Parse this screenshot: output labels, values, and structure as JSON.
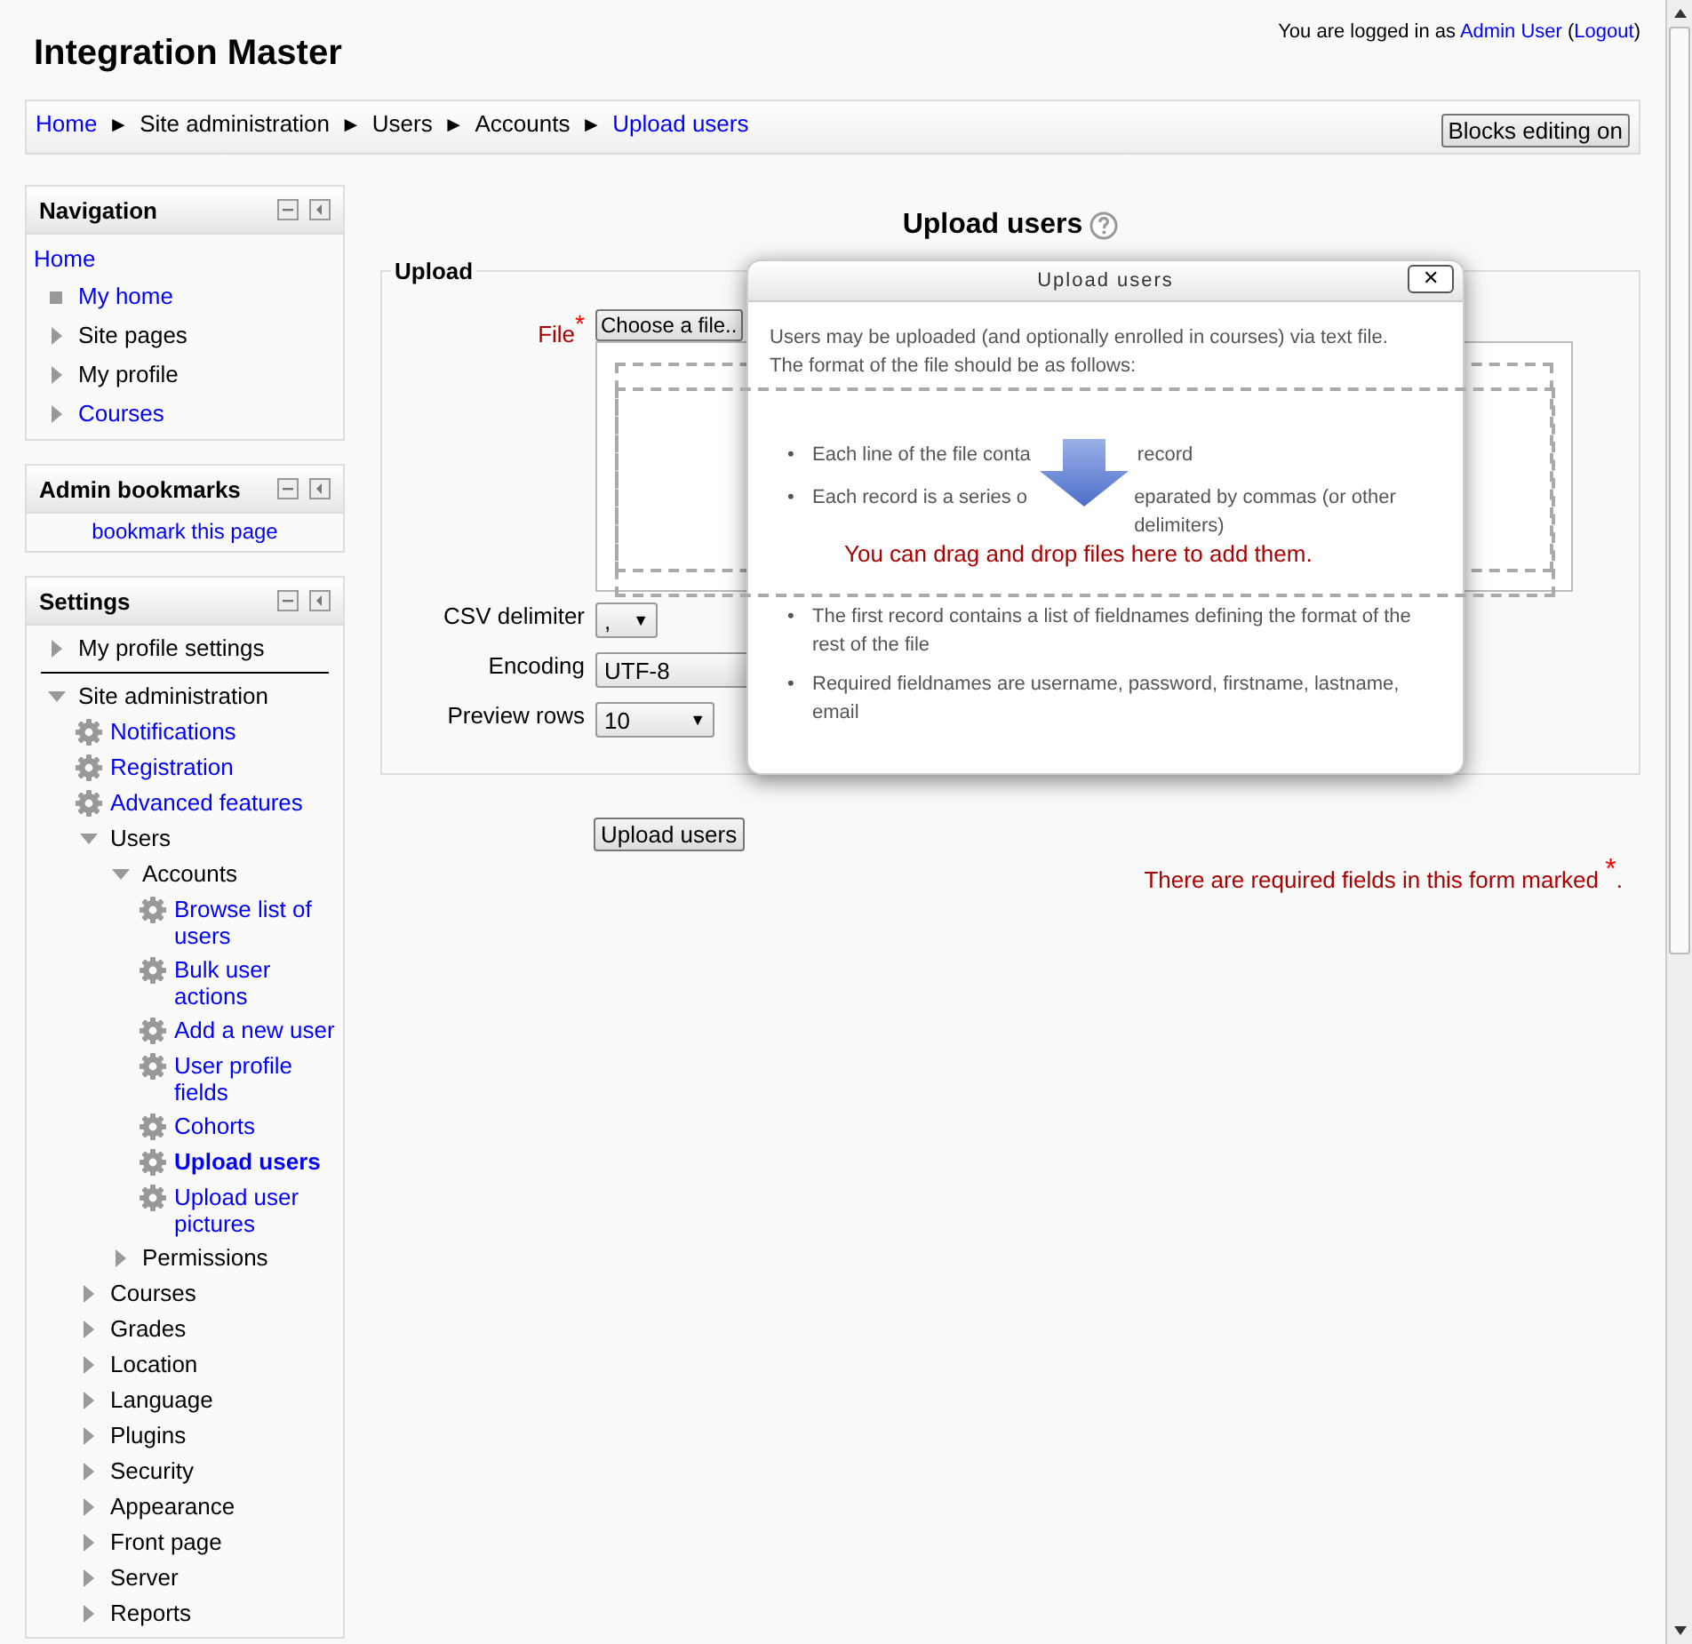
{
  "header": {
    "title": "Integration Master",
    "login": {
      "prefix": "You are logged in as",
      "user": "Admin User",
      "open": "(",
      "logout": "Logout",
      "close": ")"
    }
  },
  "breadcrumb": {
    "items": [
      {
        "label": "Home",
        "link": true
      },
      {
        "label": "Site administration",
        "link": false
      },
      {
        "label": "Users",
        "link": false
      },
      {
        "label": "Accounts",
        "link": false
      },
      {
        "label": "Upload users",
        "link": true
      }
    ],
    "separator": "►",
    "button": "Blocks editing on"
  },
  "navigation": {
    "title": "Navigation",
    "items": [
      {
        "label": "Home",
        "kind": "plain-link"
      },
      {
        "label": "My home",
        "kind": "bullet-link"
      },
      {
        "label": "Site pages",
        "kind": "branch",
        "expanded": false,
        "link": false
      },
      {
        "label": "My profile",
        "kind": "branch",
        "expanded": false,
        "link": false
      },
      {
        "label": "Courses",
        "kind": "branch",
        "expanded": false,
        "link": true
      }
    ]
  },
  "bookmarks": {
    "title": "Admin bookmarks",
    "link": "bookmark this page"
  },
  "settings": {
    "title": "Settings",
    "items": [
      {
        "label": "My profile settings",
        "kind": "branch",
        "expanded": false,
        "link": false
      },
      {
        "label": "Site administration",
        "kind": "branch",
        "expanded": true,
        "link": false,
        "children": [
          {
            "label": "Notifications",
            "kind": "setting",
            "current": false
          },
          {
            "label": "Registration",
            "kind": "setting",
            "current": false
          },
          {
            "label": "Advanced features",
            "kind": "setting",
            "current": false
          },
          {
            "label": "Users",
            "kind": "branch",
            "expanded": true,
            "link": false,
            "children": [
              {
                "label": "Accounts",
                "kind": "branch",
                "expanded": true,
                "link": false,
                "children": [
                  {
                    "label": "Browse list of users",
                    "kind": "setting",
                    "current": false
                  },
                  {
                    "label": "Bulk user actions",
                    "kind": "setting",
                    "current": false
                  },
                  {
                    "label": "Add a new user",
                    "kind": "setting",
                    "current": false
                  },
                  {
                    "label": "User profile fields",
                    "kind": "setting",
                    "current": false
                  },
                  {
                    "label": "Cohorts",
                    "kind": "setting",
                    "current": false
                  },
                  {
                    "label": "Upload users",
                    "kind": "setting",
                    "current": true
                  },
                  {
                    "label": "Upload user pictures",
                    "kind": "setting",
                    "current": false
                  }
                ]
              },
              {
                "label": "Permissions",
                "kind": "branch",
                "expanded": false,
                "link": false
              }
            ]
          },
          {
            "label": "Courses",
            "kind": "branch",
            "expanded": false,
            "link": false
          },
          {
            "label": "Grades",
            "kind": "branch",
            "expanded": false,
            "link": false
          },
          {
            "label": "Location",
            "kind": "branch",
            "expanded": false,
            "link": false
          },
          {
            "label": "Language",
            "kind": "branch",
            "expanded": false,
            "link": false
          },
          {
            "label": "Plugins",
            "kind": "branch",
            "expanded": false,
            "link": false
          },
          {
            "label": "Security",
            "kind": "branch",
            "expanded": false,
            "link": false
          },
          {
            "label": "Appearance",
            "kind": "branch",
            "expanded": false,
            "link": false
          },
          {
            "label": "Front page",
            "kind": "branch",
            "expanded": false,
            "link": false
          },
          {
            "label": "Server",
            "kind": "branch",
            "expanded": false,
            "link": false
          },
          {
            "label": "Reports",
            "kind": "branch",
            "expanded": false,
            "link": false
          }
        ]
      }
    ]
  },
  "main": {
    "heading": "Upload users",
    "fieldset": "Upload",
    "file": {
      "label": "File",
      "required": "*",
      "button": "Choose a file..",
      "drop_text": "You can drag and drop files here to add them."
    },
    "fields": [
      {
        "label": "CSV delimiter",
        "value": ","
      },
      {
        "label": "Encoding",
        "value": "UTF-8"
      },
      {
        "label": "Preview rows",
        "value": "10"
      }
    ],
    "dropdown_arrow": "▼",
    "submit": "Upload users",
    "notice": "There are required fields in this form marked",
    "notice_mark": "*",
    "notice_end": "."
  },
  "dialog": {
    "title": "Upload users",
    "close": "✕",
    "intro": "Users may be uploaded (and optionally enrolled in courses) via text file. The format of the file should be as follows:",
    "bullet_mark": "•",
    "bullets": [
      {
        "parts": [
          "Each line of the file conta",
          "record"
        ]
      },
      {
        "parts": [
          "Each record is a series o",
          "eparated by commas (or other delimiters)"
        ]
      },
      {
        "parts": [
          "The first record contains a list of fieldnames defining the format of the rest of the file"
        ]
      },
      {
        "parts": [
          "Required fieldnames are username, password, firstname, lastname, email"
        ]
      }
    ]
  }
}
